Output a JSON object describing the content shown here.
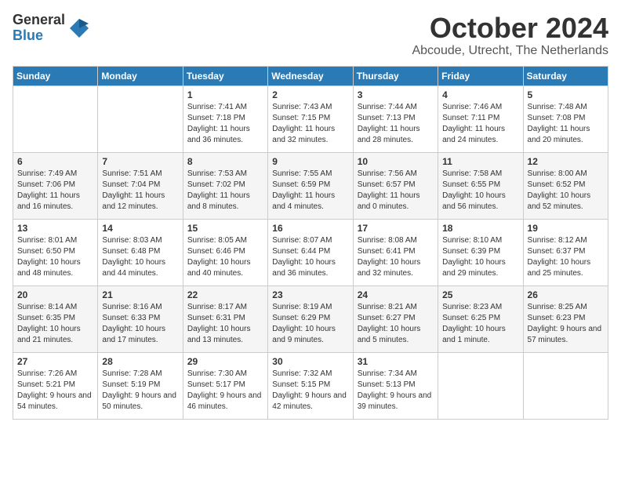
{
  "logo": {
    "line1": "General",
    "line2": "Blue"
  },
  "title": "October 2024",
  "subtitle": "Abcoude, Utrecht, The Netherlands",
  "headers": [
    "Sunday",
    "Monday",
    "Tuesday",
    "Wednesday",
    "Thursday",
    "Friday",
    "Saturday"
  ],
  "weeks": [
    [
      {
        "day": "",
        "sunrise": "",
        "sunset": "",
        "daylight": ""
      },
      {
        "day": "",
        "sunrise": "",
        "sunset": "",
        "daylight": ""
      },
      {
        "day": "1",
        "sunrise": "Sunrise: 7:41 AM",
        "sunset": "Sunset: 7:18 PM",
        "daylight": "Daylight: 11 hours and 36 minutes."
      },
      {
        "day": "2",
        "sunrise": "Sunrise: 7:43 AM",
        "sunset": "Sunset: 7:15 PM",
        "daylight": "Daylight: 11 hours and 32 minutes."
      },
      {
        "day": "3",
        "sunrise": "Sunrise: 7:44 AM",
        "sunset": "Sunset: 7:13 PM",
        "daylight": "Daylight: 11 hours and 28 minutes."
      },
      {
        "day": "4",
        "sunrise": "Sunrise: 7:46 AM",
        "sunset": "Sunset: 7:11 PM",
        "daylight": "Daylight: 11 hours and 24 minutes."
      },
      {
        "day": "5",
        "sunrise": "Sunrise: 7:48 AM",
        "sunset": "Sunset: 7:08 PM",
        "daylight": "Daylight: 11 hours and 20 minutes."
      }
    ],
    [
      {
        "day": "6",
        "sunrise": "Sunrise: 7:49 AM",
        "sunset": "Sunset: 7:06 PM",
        "daylight": "Daylight: 11 hours and 16 minutes."
      },
      {
        "day": "7",
        "sunrise": "Sunrise: 7:51 AM",
        "sunset": "Sunset: 7:04 PM",
        "daylight": "Daylight: 11 hours and 12 minutes."
      },
      {
        "day": "8",
        "sunrise": "Sunrise: 7:53 AM",
        "sunset": "Sunset: 7:02 PM",
        "daylight": "Daylight: 11 hours and 8 minutes."
      },
      {
        "day": "9",
        "sunrise": "Sunrise: 7:55 AM",
        "sunset": "Sunset: 6:59 PM",
        "daylight": "Daylight: 11 hours and 4 minutes."
      },
      {
        "day": "10",
        "sunrise": "Sunrise: 7:56 AM",
        "sunset": "Sunset: 6:57 PM",
        "daylight": "Daylight: 11 hours and 0 minutes."
      },
      {
        "day": "11",
        "sunrise": "Sunrise: 7:58 AM",
        "sunset": "Sunset: 6:55 PM",
        "daylight": "Daylight: 10 hours and 56 minutes."
      },
      {
        "day": "12",
        "sunrise": "Sunrise: 8:00 AM",
        "sunset": "Sunset: 6:52 PM",
        "daylight": "Daylight: 10 hours and 52 minutes."
      }
    ],
    [
      {
        "day": "13",
        "sunrise": "Sunrise: 8:01 AM",
        "sunset": "Sunset: 6:50 PM",
        "daylight": "Daylight: 10 hours and 48 minutes."
      },
      {
        "day": "14",
        "sunrise": "Sunrise: 8:03 AM",
        "sunset": "Sunset: 6:48 PM",
        "daylight": "Daylight: 10 hours and 44 minutes."
      },
      {
        "day": "15",
        "sunrise": "Sunrise: 8:05 AM",
        "sunset": "Sunset: 6:46 PM",
        "daylight": "Daylight: 10 hours and 40 minutes."
      },
      {
        "day": "16",
        "sunrise": "Sunrise: 8:07 AM",
        "sunset": "Sunset: 6:44 PM",
        "daylight": "Daylight: 10 hours and 36 minutes."
      },
      {
        "day": "17",
        "sunrise": "Sunrise: 8:08 AM",
        "sunset": "Sunset: 6:41 PM",
        "daylight": "Daylight: 10 hours and 32 minutes."
      },
      {
        "day": "18",
        "sunrise": "Sunrise: 8:10 AM",
        "sunset": "Sunset: 6:39 PM",
        "daylight": "Daylight: 10 hours and 29 minutes."
      },
      {
        "day": "19",
        "sunrise": "Sunrise: 8:12 AM",
        "sunset": "Sunset: 6:37 PM",
        "daylight": "Daylight: 10 hours and 25 minutes."
      }
    ],
    [
      {
        "day": "20",
        "sunrise": "Sunrise: 8:14 AM",
        "sunset": "Sunset: 6:35 PM",
        "daylight": "Daylight: 10 hours and 21 minutes."
      },
      {
        "day": "21",
        "sunrise": "Sunrise: 8:16 AM",
        "sunset": "Sunset: 6:33 PM",
        "daylight": "Daylight: 10 hours and 17 minutes."
      },
      {
        "day": "22",
        "sunrise": "Sunrise: 8:17 AM",
        "sunset": "Sunset: 6:31 PM",
        "daylight": "Daylight: 10 hours and 13 minutes."
      },
      {
        "day": "23",
        "sunrise": "Sunrise: 8:19 AM",
        "sunset": "Sunset: 6:29 PM",
        "daylight": "Daylight: 10 hours and 9 minutes."
      },
      {
        "day": "24",
        "sunrise": "Sunrise: 8:21 AM",
        "sunset": "Sunset: 6:27 PM",
        "daylight": "Daylight: 10 hours and 5 minutes."
      },
      {
        "day": "25",
        "sunrise": "Sunrise: 8:23 AM",
        "sunset": "Sunset: 6:25 PM",
        "daylight": "Daylight: 10 hours and 1 minute."
      },
      {
        "day": "26",
        "sunrise": "Sunrise: 8:25 AM",
        "sunset": "Sunset: 6:23 PM",
        "daylight": "Daylight: 9 hours and 57 minutes."
      }
    ],
    [
      {
        "day": "27",
        "sunrise": "Sunrise: 7:26 AM",
        "sunset": "Sunset: 5:21 PM",
        "daylight": "Daylight: 9 hours and 54 minutes."
      },
      {
        "day": "28",
        "sunrise": "Sunrise: 7:28 AM",
        "sunset": "Sunset: 5:19 PM",
        "daylight": "Daylight: 9 hours and 50 minutes."
      },
      {
        "day": "29",
        "sunrise": "Sunrise: 7:30 AM",
        "sunset": "Sunset: 5:17 PM",
        "daylight": "Daylight: 9 hours and 46 minutes."
      },
      {
        "day": "30",
        "sunrise": "Sunrise: 7:32 AM",
        "sunset": "Sunset: 5:15 PM",
        "daylight": "Daylight: 9 hours and 42 minutes."
      },
      {
        "day": "31",
        "sunrise": "Sunrise: 7:34 AM",
        "sunset": "Sunset: 5:13 PM",
        "daylight": "Daylight: 9 hours and 39 minutes."
      },
      {
        "day": "",
        "sunrise": "",
        "sunset": "",
        "daylight": ""
      },
      {
        "day": "",
        "sunrise": "",
        "sunset": "",
        "daylight": ""
      }
    ]
  ]
}
